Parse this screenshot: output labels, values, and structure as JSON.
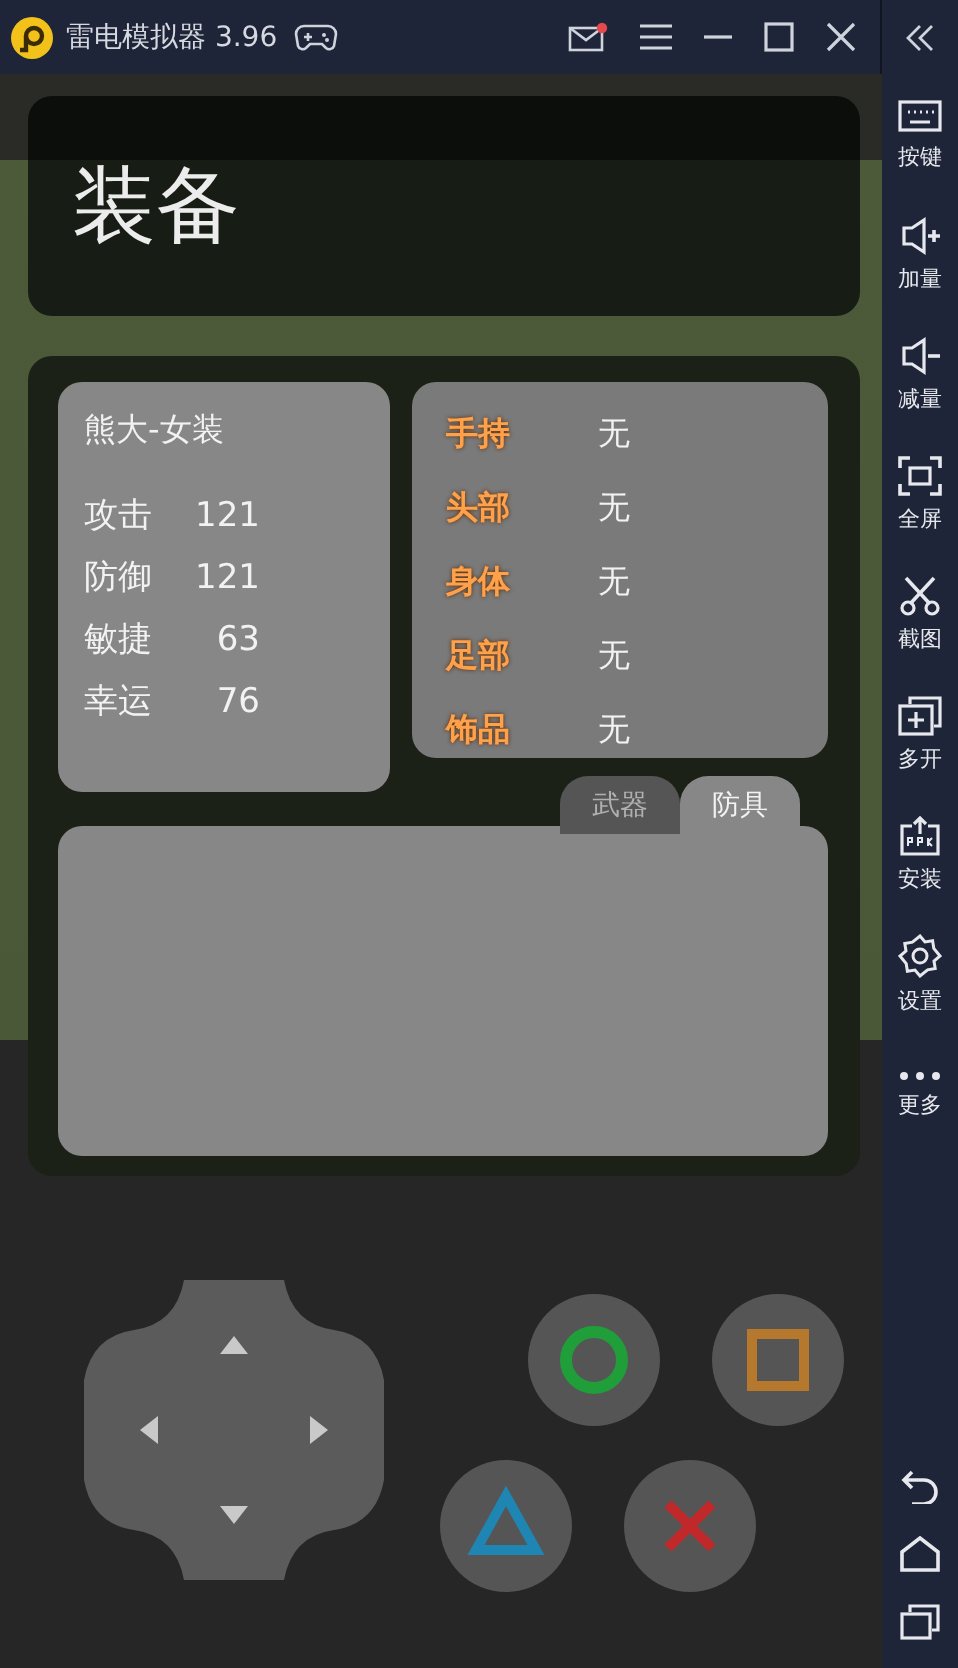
{
  "window": {
    "title": "雷电模拟器 3.96",
    "mail_unread": true
  },
  "sidebar": [
    {
      "kind": "keyboard",
      "label": "按键"
    },
    {
      "kind": "volume-up",
      "label": "加量"
    },
    {
      "kind": "volume-down",
      "label": "减量"
    },
    {
      "kind": "fullscreen",
      "label": "全屏"
    },
    {
      "kind": "screenshot",
      "label": "截图"
    },
    {
      "kind": "multi",
      "label": "多开"
    },
    {
      "kind": "install",
      "label": "安装"
    },
    {
      "kind": "settings",
      "label": "设置"
    },
    {
      "kind": "more",
      "label": "更多"
    }
  ],
  "game": {
    "title": "装备",
    "character": {
      "name": "熊大-女装",
      "stats": [
        {
          "label": "攻击",
          "value": "121"
        },
        {
          "label": "防御",
          "value": "121"
        },
        {
          "label": "敏捷",
          "value": "63"
        },
        {
          "label": "幸运",
          "value": "76"
        }
      ]
    },
    "slots": [
      {
        "label": "手持",
        "value": "无"
      },
      {
        "label": "头部",
        "value": "无"
      },
      {
        "label": "身体",
        "value": "无"
      },
      {
        "label": "足部",
        "value": "无"
      },
      {
        "label": "饰品",
        "value": "无"
      }
    ],
    "tabs": [
      {
        "label": "武器",
        "selected": false
      },
      {
        "label": "防具",
        "selected": true
      }
    ]
  }
}
